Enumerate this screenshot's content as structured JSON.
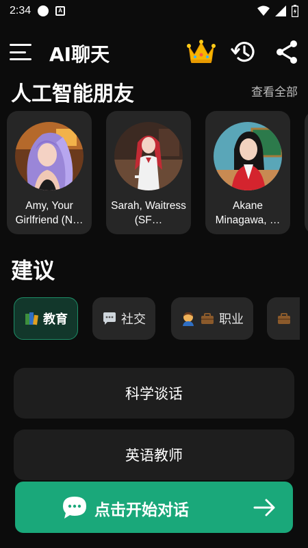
{
  "status_bar": {
    "time": "2:34"
  },
  "app_bar": {
    "title": "AI聊天",
    "icons": [
      "menu-icon",
      "crown-icon",
      "history-icon",
      "share-icon"
    ]
  },
  "friends_section": {
    "title": "人工智能朋友",
    "see_all_label": "查看全部",
    "cards": [
      {
        "name": "Amy, Your Girlfriend (N…"
      },
      {
        "name": "Sarah, Waitress (SF…"
      },
      {
        "name": "Akane Minagawa, …"
      }
    ]
  },
  "suggestions": {
    "title": "建议",
    "chips": [
      {
        "label": "教育",
        "icon": "books-icon",
        "selected": true
      },
      {
        "label": "社交",
        "icon": "speech-bubble-icon",
        "selected": false
      },
      {
        "label": "职业",
        "icon": "person-briefcase-icon",
        "selected": false
      },
      {
        "label": "",
        "icon": "briefcase-icon",
        "selected": false
      }
    ],
    "items": [
      {
        "label": "科学谈话"
      },
      {
        "label": "英语教师"
      }
    ]
  },
  "cta": {
    "label": "点击开始对话"
  },
  "colors": {
    "background": "#0c0c0c",
    "card": "#262626",
    "accent_green": "#1aa87a",
    "chip_active_bg": "#12372b",
    "chip_active_border": "#1e8f68"
  }
}
